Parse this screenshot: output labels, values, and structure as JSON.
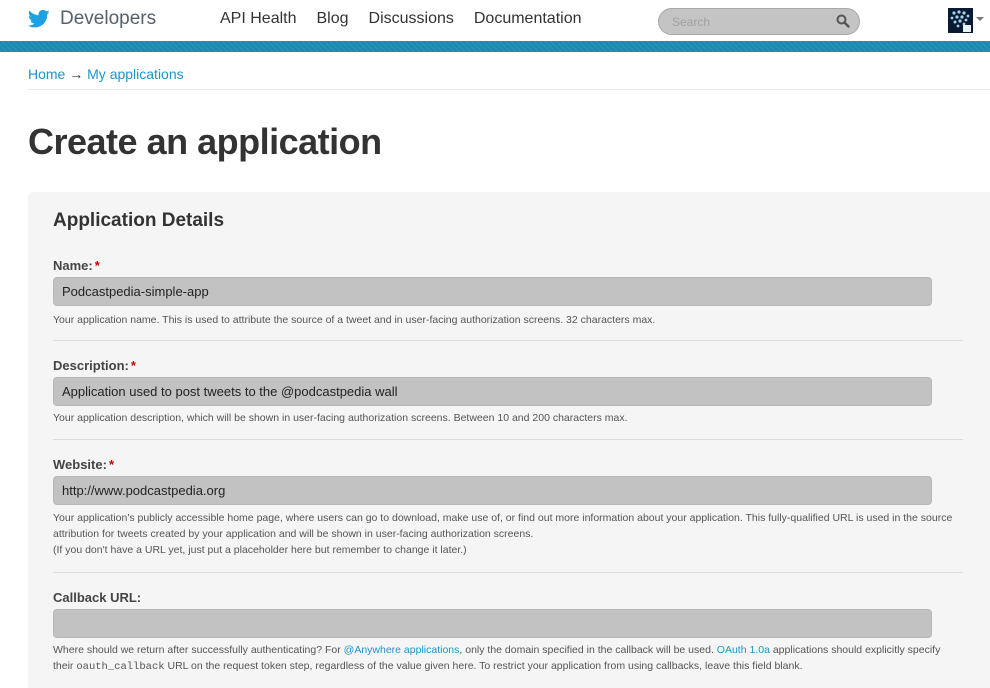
{
  "header": {
    "brand": "Developers",
    "nav": [
      "API Health",
      "Blog",
      "Discussions",
      "Documentation"
    ],
    "search_placeholder": "Search"
  },
  "breadcrumb": {
    "home": "Home",
    "arrow": "→",
    "current": "My applications"
  },
  "page_title": "Create an application",
  "panel": {
    "title": "Application Details",
    "fields": {
      "name": {
        "label": "Name:",
        "required": "*",
        "value": "Podcastpedia-simple-app",
        "help": "Your application name. This is used to attribute the source of a tweet and in user-facing authorization screens. 32 characters max."
      },
      "description": {
        "label": "Description:",
        "required": "*",
        "value": "Application used to post tweets to the @podcastpedia wall",
        "help": "Your application description, which will be shown in user-facing authorization screens. Between 10 and 200 characters max."
      },
      "website": {
        "label": "Website:",
        "required": "*",
        "value": "http://www.podcastpedia.org",
        "help_line1": "Your application's publicly accessible home page, where users can go to download, make use of, or find out more information about your application. This fully-qualified URL is used in the source attribution for tweets created by your application and will be shown in user-facing authorization screens.",
        "help_line2": "(If you don't have a URL yet, just put a placeholder here but remember to change it later.)"
      },
      "callback": {
        "label": "Callback URL:",
        "value": "",
        "help_part1": "Where should we return after successfully authenticating? For ",
        "help_link1": "@Anywhere applications",
        "help_part2": ", only the domain specified in the callback will be used. ",
        "help_link2": "OAuth 1.0a",
        "help_part3": " applications should explicitly specify their ",
        "help_code": "oauth_callback",
        "help_part4": " URL on the request token step, regardless of the value given here. To restrict your application from using callbacks, leave this field blank."
      }
    }
  },
  "colors": {
    "accent_blue": "#1d88b2",
    "link": "#1d95c9",
    "required": "#cc0000"
  },
  "icons": [
    "twitter-bird-icon",
    "search-icon",
    "avatar",
    "chevron-down-icon"
  ]
}
